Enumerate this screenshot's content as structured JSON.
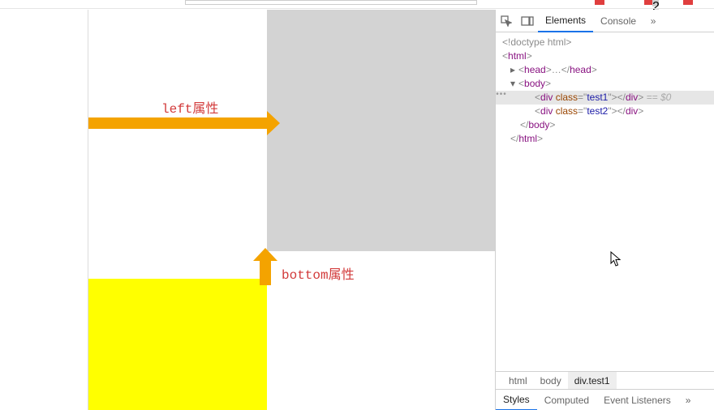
{
  "topbar": {
    "badge_count": "2"
  },
  "viewport": {
    "boxes": {
      "grey_class": "test1",
      "yellow_class": "test2"
    },
    "annotations": {
      "left_label": "left属性",
      "bottom_label": "bottom属性"
    }
  },
  "devtools": {
    "tabs": {
      "elements": "Elements",
      "console": "Console"
    },
    "dom": {
      "doctype": "<!doctype html>",
      "html_open": "html",
      "head": "head",
      "body": "body",
      "div": "div",
      "class_attr": "class",
      "test1": "test1",
      "test2": "test2",
      "selected_suffix": " == $0"
    },
    "breadcrumb": {
      "html": "html",
      "body": "body",
      "sel": "div.test1"
    },
    "styles_tabs": {
      "styles": "Styles",
      "computed": "Computed",
      "events": "Event Listeners"
    }
  }
}
